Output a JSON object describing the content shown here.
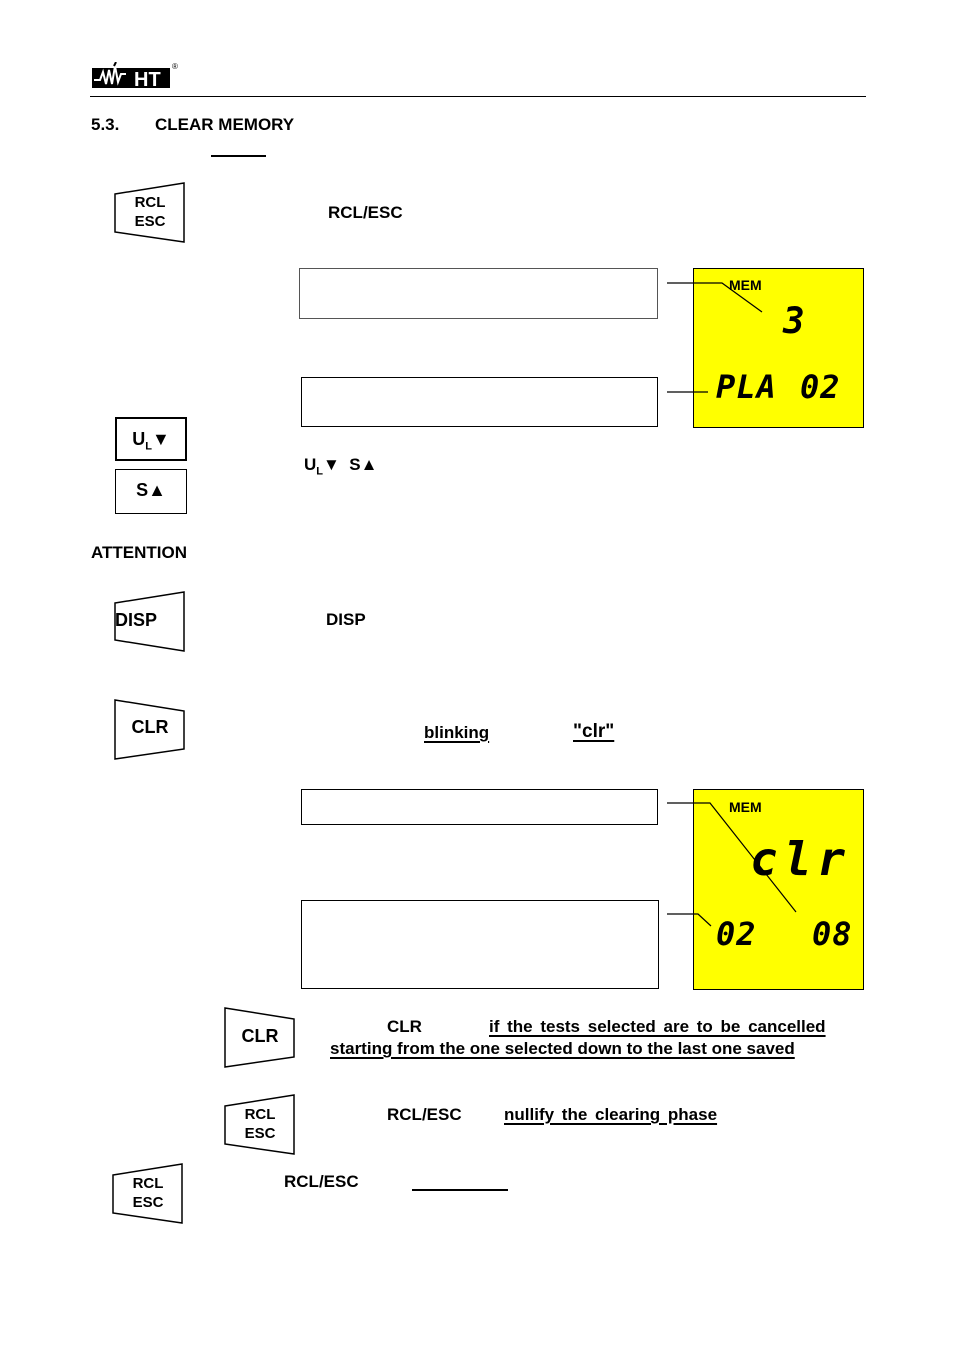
{
  "header": {
    "logo_text": "HT",
    "logo_registered": "®"
  },
  "section": {
    "number": "5.3.",
    "title": "CLEAR MEMORY"
  },
  "step1": {
    "key_label_line1": "RCL",
    "key_label_line2": "ESC",
    "text": "RCL/ESC"
  },
  "display1": {
    "mem_label": "MEM",
    "main_value": "3",
    "bottom_left": "PLA",
    "bottom_right": "02",
    "background_color": "#ffff00"
  },
  "step2": {
    "key_down_label": "U",
    "key_down_sub": "L",
    "key_down_arrow": "▼",
    "key_up_label": "S",
    "key_up_arrow": "▲",
    "text_down": "U",
    "text_down_sub": "L",
    "text_down_arrow": "▼",
    "text_up": "S▲"
  },
  "attention": {
    "label": "ATTENTION"
  },
  "step3": {
    "key_label": "DISP",
    "text": "DISP"
  },
  "step4": {
    "key_label": "CLR",
    "blinking": "blinking",
    "clr_word": "\"clr\""
  },
  "display2": {
    "mem_label": "MEM",
    "main_value": "clr",
    "bottom_left": "02",
    "bottom_right": "08",
    "background_color": "#ffff00"
  },
  "step5": {
    "key_label": "CLR",
    "text_key": "CLR",
    "text_line1": "if the tests selected are to be cancelled",
    "text_line2": "starting from the one selected down to the last one saved"
  },
  "step6": {
    "key_label_line1": "RCL",
    "key_label_line2": "ESC",
    "text_key": "RCL/ESC",
    "text": "nullify the clearing phase"
  },
  "step7": {
    "key_label_line1": "RCL",
    "key_label_line2": "ESC",
    "text_key": "RCL/ESC"
  }
}
